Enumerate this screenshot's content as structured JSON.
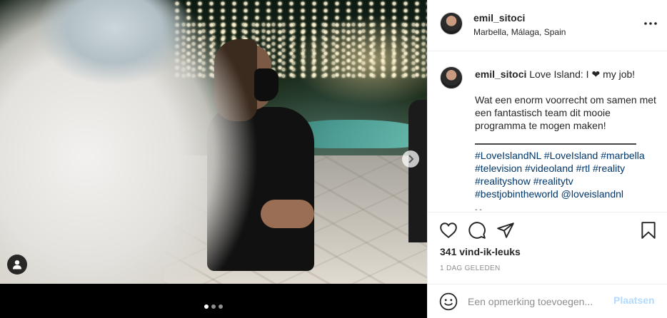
{
  "post": {
    "username": "emil_sitoci",
    "location": "Marbella, Málaga, Spain",
    "more_icon": "more-horizontal-icon"
  },
  "caption": {
    "username": "emil_sitoci",
    "first_line_a": "Love Island: I",
    "heart": "❤",
    "first_line_b": "my job!",
    "paragraph": "Wat een enorm voorrecht om samen met een fantastisch team dit mooie programma te mogen maken!",
    "hashtags": [
      "#LoveIslandNL",
      "#LoveIsland",
      "#marbella",
      "#television",
      "#videoland",
      "#rtl",
      "#reality",
      "#realityshow",
      "#realitytv",
      "#bestjobintheworld",
      "@loveislandnl"
    ],
    "truncated": "• •"
  },
  "actions": {
    "likes": "341 vind-ik-leuks",
    "time": "1 DAG GELEDEN"
  },
  "comment": {
    "placeholder": "Een opmerking toevoegen...",
    "post_label": "Plaatsen"
  },
  "carousel": {
    "count": 3,
    "active": 0
  },
  "colors": {
    "hashtag": "#00376b",
    "post_button_disabled": "#b3dbff",
    "muted": "#8e8e8e"
  }
}
